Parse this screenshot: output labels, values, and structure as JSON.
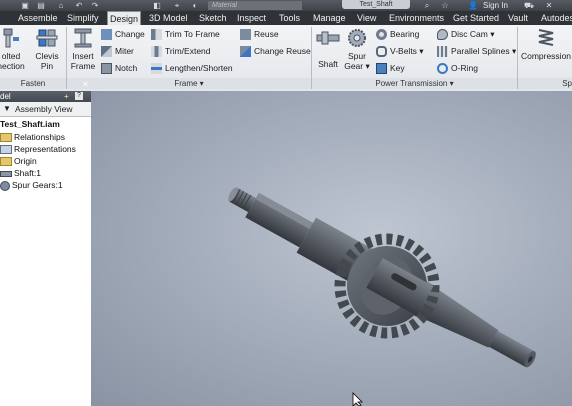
{
  "title_bar": {
    "material": "Material",
    "document": "Test_Shaft",
    "sign_in": "Sign In"
  },
  "tabs": [
    {
      "label": "Assemble"
    },
    {
      "label": "Simplify"
    },
    {
      "label": "Design",
      "active": true
    },
    {
      "label": "3D Model"
    },
    {
      "label": "Sketch"
    },
    {
      "label": "Inspect"
    },
    {
      "label": "Tools"
    },
    {
      "label": "Manage"
    },
    {
      "label": "View"
    },
    {
      "label": "Environments"
    },
    {
      "label": "Get Started"
    },
    {
      "label": "Vault"
    },
    {
      "label": "Autodes"
    }
  ],
  "fasten": {
    "bolted_line1": "olted",
    "bolted_line2": "nection",
    "clevis_line1": "Clevis",
    "clevis_line2": "Pin",
    "title": "Fasten"
  },
  "frame": {
    "insert_line1": "Insert",
    "insert_line2": "Frame",
    "change": "Change",
    "miter": "Miter",
    "notch": "Notch",
    "trim_to_frame": "Trim To Frame",
    "trim_extend": "Trim/Extend",
    "lengthen_shorten": "Lengthen/Shorten",
    "reuse": "Reuse",
    "change_reuse": "Change Reuse",
    "title": "Frame"
  },
  "power_transmission": {
    "shaft": "Shaft",
    "spur_line1": "Spur",
    "spur_line2": "Gear",
    "bearing": "Bearing",
    "v_belts": "V-Belts",
    "key": "Key",
    "disc_cam": "Disc Cam",
    "parallel_splines": "Parallel Splines",
    "o_ring": "O-Ring",
    "title": "Power Transmission"
  },
  "spring": {
    "compression": "Compression",
    "title": "Sp"
  },
  "browser": {
    "title": "del",
    "help": "?",
    "view": "Assembly View",
    "root": "Test_Shaft.iam",
    "items": [
      {
        "label": "Relationships"
      },
      {
        "label": "Representations"
      },
      {
        "label": "Origin"
      },
      {
        "label": "Shaft:1"
      },
      {
        "label": "Spur Gears:1"
      }
    ]
  },
  "colors": {
    "ribbon_bg": "#e6e9ec",
    "tab_bar": "#2f3338",
    "viewport_bg": "#a5aebc",
    "part_metal": "#5b6068"
  }
}
